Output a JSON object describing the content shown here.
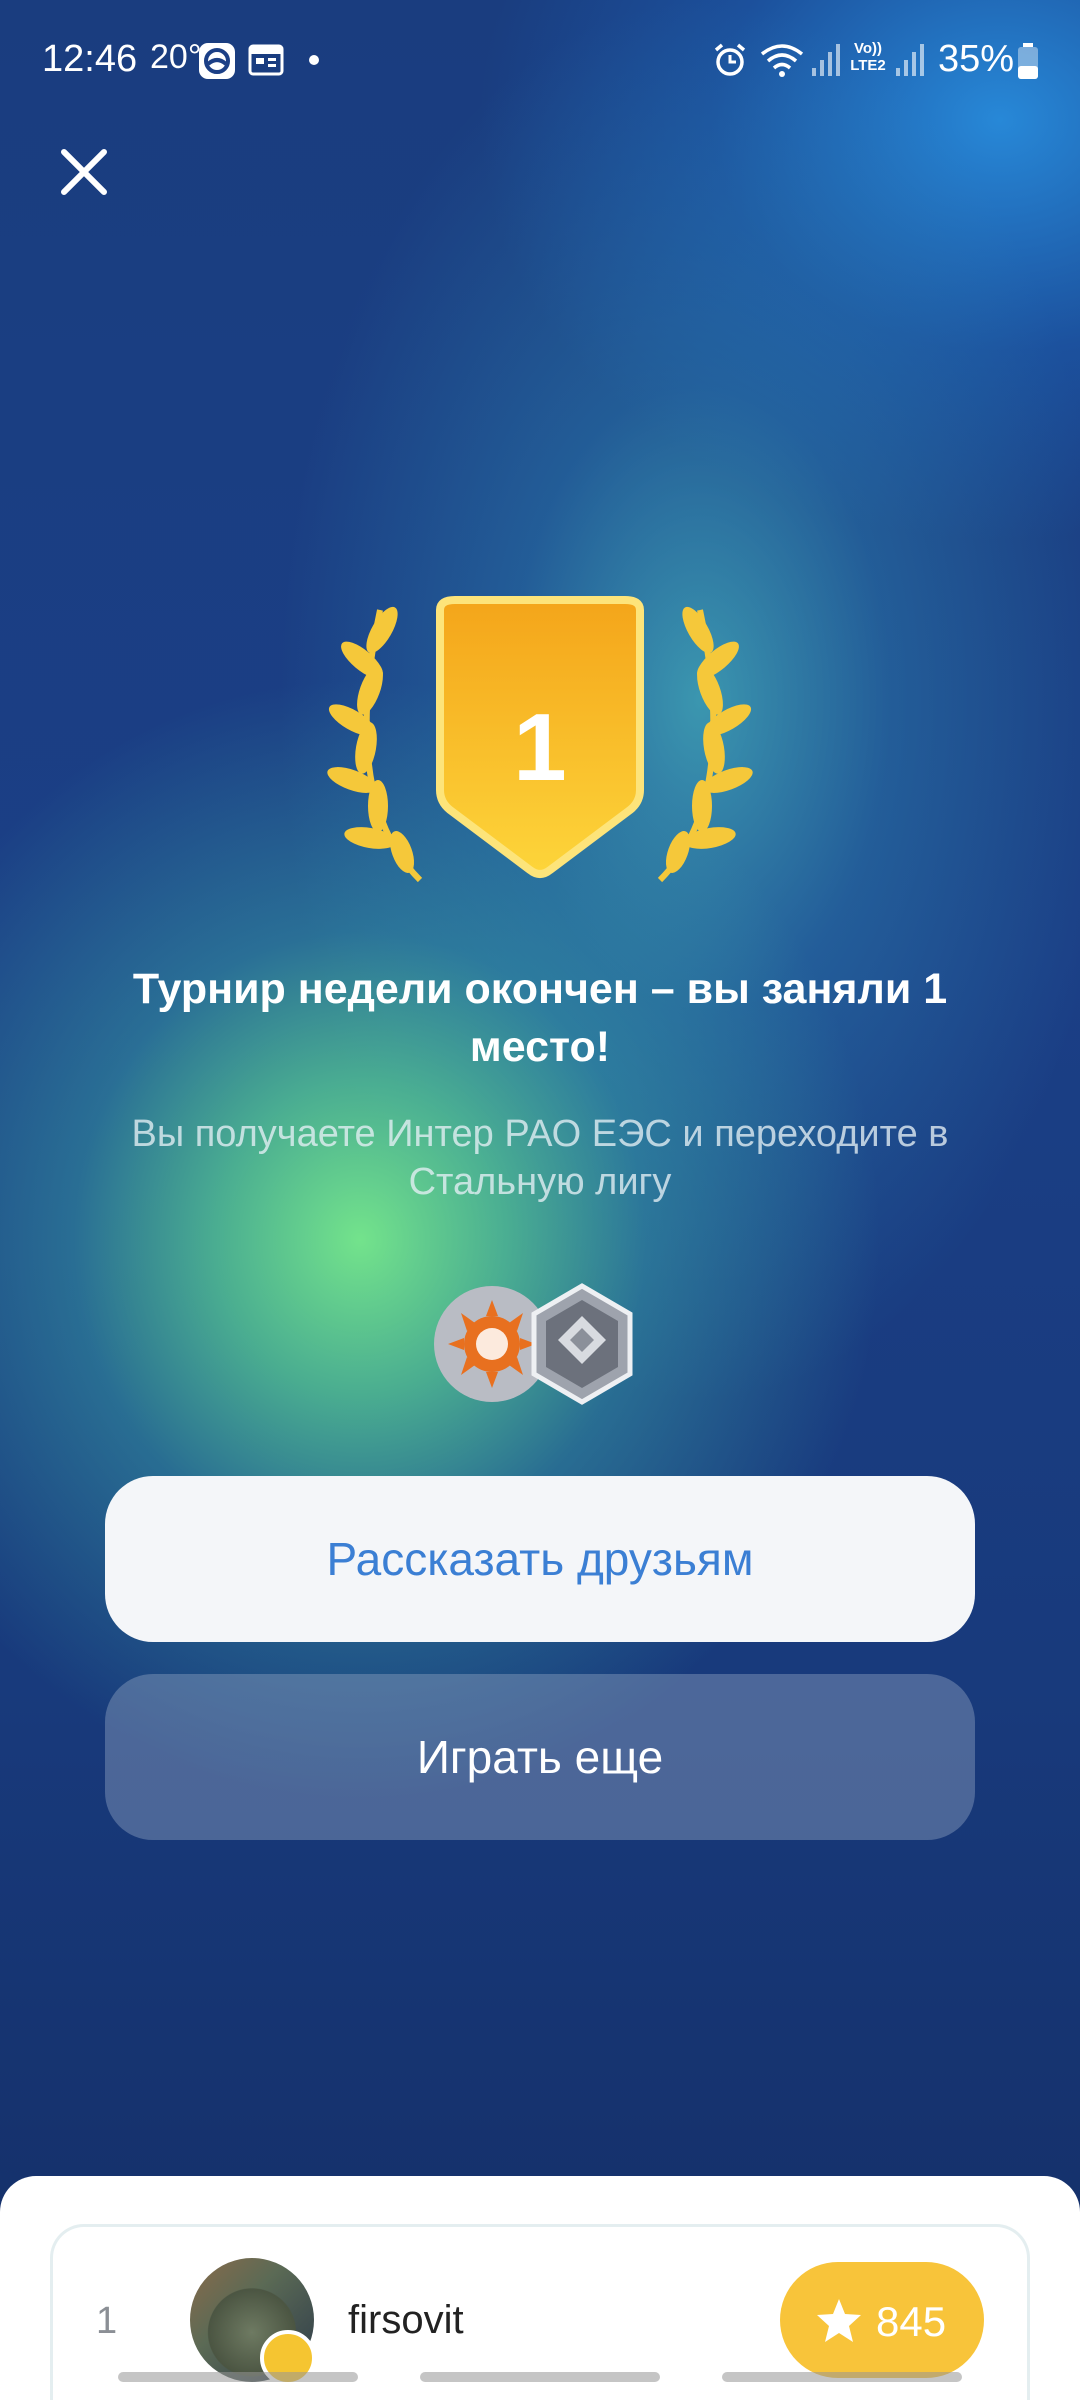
{
  "status_bar": {
    "time": "12:46",
    "temperature": "20°",
    "battery": "35%",
    "icons": [
      "weather-icon",
      "calendar-icon",
      "notification-dot-icon",
      "alarm-icon",
      "wifi-icon",
      "signal-icon",
      "volte-icon",
      "signal-icon-2",
      "battery-icon"
    ],
    "volte_label": "Vo)) LTE2"
  },
  "close_icon": "close-icon",
  "trophy": {
    "place_number": "1",
    "colors": {
      "shield": "#f7b81a",
      "laurel": "#f5c83a"
    }
  },
  "result": {
    "title": "Турнир недели окончен – вы заняли 1 место!",
    "subtitle": "Вы получаете Интер РАО ЕЭС и переходите в Стальную лигу"
  },
  "reward_badges": [
    "inter-rao-logo-icon",
    "steel-league-icon"
  ],
  "buttons": {
    "share": "Рассказать друзьям",
    "play_again": "Играть еще"
  },
  "leaderboard": {
    "rows": [
      {
        "rank": "1",
        "username": "firsovit",
        "score": "845"
      }
    ]
  },
  "colors": {
    "accent_blue": "#3b7fd4",
    "score_yellow": "#f8c43a"
  }
}
